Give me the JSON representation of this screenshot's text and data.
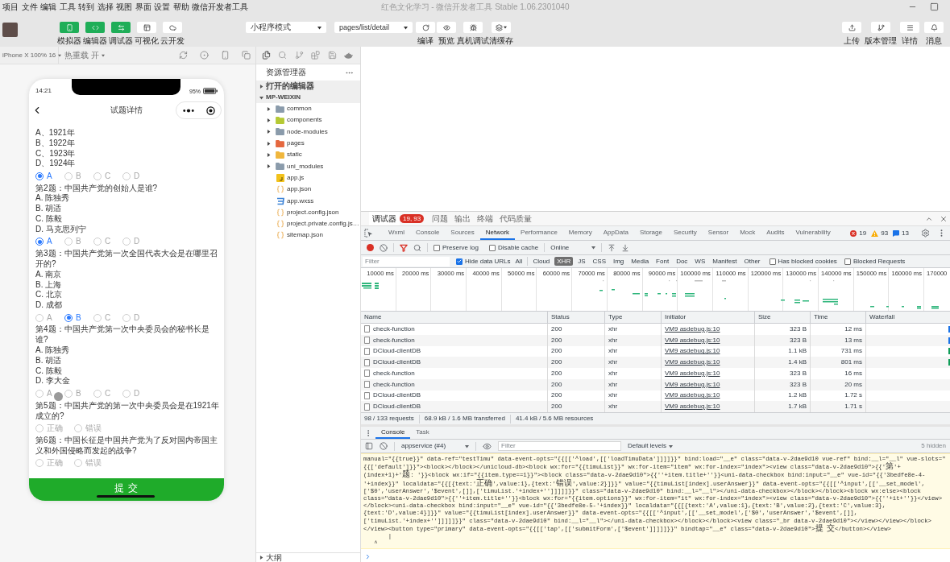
{
  "window": {
    "title": "红色文化学习 - 微信开发者工具 Stable 1.06.2301040"
  },
  "menu": [
    "项目",
    "文件",
    "编辑",
    "工具",
    "转到",
    "选择",
    "视图",
    "界面",
    "设置",
    "帮助",
    "微信开发者工具"
  ],
  "toolbar": {
    "modes": [
      {
        "kind": "simulator",
        "label": "模拟器",
        "selected": true
      },
      {
        "kind": "editor",
        "label": "编辑器",
        "selected": true
      },
      {
        "kind": "debugger",
        "label": "调试器",
        "selected": true
      },
      {
        "kind": "visual",
        "label": "可视化",
        "selected": false
      },
      {
        "kind": "cloud",
        "label": "云开发",
        "selected": false
      }
    ],
    "compile_mode": "小程序模式",
    "page_path": "pages/list/detail",
    "actions": [
      {
        "kind": "compile",
        "label": "编译"
      },
      {
        "kind": "preview",
        "label": "预览"
      },
      {
        "kind": "debug",
        "label": "真机调试"
      },
      {
        "kind": "cache",
        "label": "清缓存"
      }
    ],
    "right_actions": [
      {
        "kind": "upload",
        "label": "上传"
      },
      {
        "kind": "version",
        "label": "版本管理"
      },
      {
        "kind": "details",
        "label": "详情"
      },
      {
        "kind": "messages",
        "label": "消息"
      }
    ]
  },
  "simulator": {
    "device": "iPhone X 100% 16",
    "hot_reload": "热重载 开",
    "phone": {
      "time": "14:21",
      "battery": "95%",
      "title": "试题详情",
      "questions": [
        {
          "options": [
            "A、1921年",
            "B、1922年",
            "C、1923年",
            "D、1924年"
          ],
          "choices": [
            {
              "label": "A",
              "selected": true
            },
            {
              "label": "B",
              "selected": false
            },
            {
              "label": "C",
              "selected": false
            },
            {
              "label": "D",
              "selected": false
            }
          ]
        },
        {
          "title": "第2题：中国共产党的创始人是谁?",
          "options": [
            "A. 陈独秀",
            "B. 胡适",
            "C. 陈毅",
            "D. 马克思列宁"
          ],
          "choices": [
            {
              "label": "A",
              "selected": true
            },
            {
              "label": "B",
              "selected": false
            },
            {
              "label": "C",
              "selected": false
            },
            {
              "label": "D",
              "selected": false
            }
          ]
        },
        {
          "title": "第3题：中国共产党第一次全国代表大会是在哪里召开的?",
          "options": [
            "A. 南京",
            "B. 上海",
            "C. 北京",
            "D. 成都"
          ],
          "choices": [
            {
              "label": "A",
              "selected": false
            },
            {
              "label": "B",
              "selected": true
            },
            {
              "label": "C",
              "selected": false
            },
            {
              "label": "D",
              "selected": false
            }
          ]
        },
        {
          "title": "第4题：中国共产党第一次中央委员会的秘书长是谁?",
          "options": [
            "A. 陈独秀",
            "B. 胡适",
            "C. 陈毅",
            "D. 李大金"
          ],
          "choices": [
            {
              "label": "A",
              "selected": false
            },
            {
              "label": "B",
              "selected": false
            },
            {
              "label": "C",
              "selected": false
            },
            {
              "label": "D",
              "selected": false
            }
          ]
        },
        {
          "title": "第5题：中国共产党的第一次中央委员会是在1921年成立的?",
          "choices": [
            {
              "label": "正确",
              "selected": false
            },
            {
              "label": "错误",
              "selected": false
            }
          ]
        },
        {
          "title": "第6题：中国长征是中国共产党为了反对国内帝国主义和外国侵略而发起的战争?",
          "choices": [
            {
              "label": "正确",
              "selected": false
            },
            {
              "label": "错误",
              "selected": false
            }
          ]
        }
      ],
      "submit": "提 交"
    }
  },
  "explorer": {
    "title": "资源管理器",
    "sections": [
      {
        "label": "打开的编辑器",
        "expanded": false
      },
      {
        "label": "MP-WEIXIN",
        "expanded": true,
        "children": [
          {
            "label": "common",
            "kind": "folder",
            "expanded": false,
            "color": "#8a9bab"
          },
          {
            "label": "components",
            "kind": "folder",
            "expanded": false,
            "color": "#b5c934"
          },
          {
            "label": "node-modules",
            "kind": "folder",
            "expanded": false,
            "color": "#8a9bab"
          },
          {
            "label": "pages",
            "kind": "folder",
            "expanded": false,
            "color": "#e5683f"
          },
          {
            "label": "static",
            "kind": "folder",
            "expanded": false,
            "color": "#f0b63c"
          },
          {
            "label": "uni_modules",
            "kind": "folder",
            "expanded": false,
            "color": "#8a9bab"
          },
          {
            "label": "app.js",
            "kind": "js"
          },
          {
            "label": "app.json",
            "kind": "json"
          },
          {
            "label": "app.wxss",
            "kind": "css"
          },
          {
            "label": "project.config.json",
            "kind": "json"
          },
          {
            "label": "project.private.config.js…",
            "kind": "json"
          },
          {
            "label": "sitemap.json",
            "kind": "json"
          }
        ]
      }
    ],
    "outline": {
      "label": "大纲",
      "expanded": false
    }
  },
  "devtools": {
    "panels": [
      {
        "label": "调试器",
        "selected": true,
        "badge": "19, 93"
      },
      {
        "label": "问题",
        "selected": false
      },
      {
        "label": "输出",
        "selected": false
      },
      {
        "label": "终端",
        "selected": false
      },
      {
        "label": "代码质量",
        "selected": false
      }
    ],
    "tabs": [
      {
        "label": "Wxml",
        "selected": false
      },
      {
        "label": "Console",
        "selected": false
      },
      {
        "label": "Sources",
        "selected": false
      },
      {
        "label": "Network",
        "selected": true
      },
      {
        "label": "Performance",
        "selected": false
      },
      {
        "label": "Memory",
        "selected": false
      },
      {
        "label": "AppData",
        "selected": false
      },
      {
        "label": "Storage",
        "selected": false
      },
      {
        "label": "Security",
        "selected": false
      },
      {
        "label": "Sensor",
        "selected": false
      },
      {
        "label": "Mock",
        "selected": false
      },
      {
        "label": "Audits",
        "selected": false
      },
      {
        "label": "Vulnerability",
        "selected": false
      }
    ],
    "counts": {
      "errors": "19",
      "warnings": "93",
      "messages": "13"
    },
    "network": {
      "recording": true,
      "filter_shown": true,
      "preserve_log": {
        "label": "Preserve log",
        "checked": false
      },
      "disable_cache": {
        "label": "Disable cache",
        "checked": false
      },
      "throttling": "Online",
      "filter": {
        "placeholder": "Filter",
        "hide_data_urls": {
          "label": "Hide data URLs",
          "checked": true
        },
        "types": [
          {
            "label": "All",
            "selected": false
          },
          {
            "label": "Cloud",
            "selected": false
          },
          {
            "label": "XHR",
            "selected": true
          },
          {
            "label": "JS",
            "selected": false
          },
          {
            "label": "CSS",
            "selected": false
          },
          {
            "label": "Img",
            "selected": false
          },
          {
            "label": "Media",
            "selected": false
          },
          {
            "label": "Font",
            "selected": false
          },
          {
            "label": "Doc",
            "selected": false
          },
          {
            "label": "WS",
            "selected": false
          },
          {
            "label": "Manifest",
            "selected": false
          },
          {
            "label": "Other",
            "selected": false
          }
        ],
        "blocked_cookies": {
          "label": "Has blocked cookies",
          "checked": false
        },
        "blocked_requests": {
          "label": "Blocked Requests",
          "checked": false
        }
      },
      "overview_ticks": [
        "10000 ms",
        "20000 ms",
        "30000 ms",
        "40000 ms",
        "50000 ms",
        "60000 ms",
        "70000 ms",
        "80000 ms",
        "90000 ms",
        "100000 ms",
        "110000 ms",
        "120000 ms",
        "130000 ms",
        "140000 ms",
        "150000 ms",
        "160000 ms",
        "170000"
      ],
      "columns": [
        "Name",
        "Status",
        "Type",
        "Initiator",
        "Size",
        "Time",
        "Waterfall"
      ],
      "rows": [
        {
          "name": "check-function",
          "status": "200",
          "type": "xhr",
          "initiator": "VM9 asdebug.js:10",
          "size": "323 B",
          "time": "12 ms",
          "color": "#1a73e8"
        },
        {
          "name": "check-function",
          "status": "200",
          "type": "xhr",
          "initiator": "VM9 asdebug.js:10",
          "size": "323 B",
          "time": "13 ms",
          "color": "#1a73e8"
        },
        {
          "name": "DCloud-clientDB",
          "status": "200",
          "type": "xhr",
          "initiator": "VM9 asdebug.js:10",
          "size": "1.1 kB",
          "time": "731 ms",
          "color": "#0f9d58"
        },
        {
          "name": "DCloud-clientDB",
          "status": "200",
          "type": "xhr",
          "initiator": "VM9 asdebug.js:10",
          "size": "1.4 kB",
          "time": "801 ms",
          "color": "#0f9d58"
        },
        {
          "name": "check-function",
          "status": "200",
          "type": "xhr",
          "initiator": "VM9 asdebug.js:10",
          "size": "323 B",
          "time": "16 ms"
        },
        {
          "name": "check-function",
          "status": "200",
          "type": "xhr",
          "initiator": "VM9 asdebug.js:10",
          "size": "323 B",
          "time": "20 ms"
        },
        {
          "name": "DCloud-clientDB",
          "status": "200",
          "type": "xhr",
          "initiator": "VM9 asdebug.js:10",
          "size": "1.2 kB",
          "time": "1.72 s"
        },
        {
          "name": "DCloud-clientDB",
          "status": "200",
          "type": "xhr",
          "initiator": "VM9 asdebug.js:10",
          "size": "1.7 kB",
          "time": "1.71 s"
        }
      ],
      "summary": [
        "98 / 133 requests",
        "68.9 kB / 1.6 MB transferred",
        "41.4 kB / 5.6 MB resources"
      ]
    },
    "console": {
      "tabs": [
        {
          "label": "Console",
          "selected": true
        },
        {
          "label": "Task",
          "selected": false
        }
      ],
      "context": "appservice (#4)",
      "filter_placeholder": "Filter",
      "levels": "Default levels",
      "hidden": "5 hidden",
      "output": [
        "manual=\"{{true}}\" data-ref=\"testTimu\" data-event-opts=\"{{[['^load',[['loadTimuData']]]]}}\" bind:load=\"__e\" class=\"data-v-2dae9d10 vue-ref\" bind:__l=\"__l\" vue-slots=\"",
        "{{['default']}}\"><block></block></unicloud-db><block wx:for=\"{{timuList}}\" wx:for-item=\"item\" wx:for-index=\"index\"><view class=\"data-v-2dae9d10\">{{'第'+",
        "(index+1)+'题: '}}<block wx:if=\"{{item.type==1}}\"><block class=\"data-v-2dae9d10\">{{''+item.title+''}}<uni-data-checkbox bind:input=\"__e\" vue-id=\"{{'3bedfe8e-4-",
        "'+index}}\" localdata=\"{{[{text:'正确',value:1},{text:'错误',value:2}]}}\" value=\"{{timuList[index].userAnswer}}\" data-event-opts=\"{{[['^input',[['__set_model',",
        "['$0','userAnswer','$event',[]],['timuList.'+index+'']]]]]}}\" class=\"data-v-2dae9d10\" bind:__l=\"__l\"></uni-data-checkbox></block></block><block wx:else><block",
        "class=\"data-v-2dae9d10\">{{''+item.title+''}}<block wx:for=\"{{item.options}}\" wx:for-item=\"it\" wx:for-index=\"index\"><view class=\"data-v-2dae9d10\">{{''+it+''}}</view>",
        "</block><uni-data-checkbox bind:input=\"__e\" vue-id=\"{{'3bedfe8e-5-'+index}}\" localdata=\"{{[{text:'A',value:1},{text:'B',value:2},{text:'C',value:3},",
        "{text:'D',value:4}]}}\" value=\"{{timuList[index].userAnswer}}\" data-event-opts=\"{{[['^input',[['__set_model',['$0','userAnswer','$event',[]],",
        "['timuList.'+index+'']]]]]}}\" class=\"data-v-2dae9d10\" bind:__l=\"__l\"></uni-data-checkbox></block></block><view class=\"_br data-v-2dae9d10\"></view></view></block>",
        "</view><button type=\"primary\" data-event-opts=\"{{[['tap',[['submitForm',['$event']]]]]}}\" bindtap=\"__e\" class=\"data-v-2dae9d10\">提 交</button></view>",
        "       |",
        "   ^"
      ]
    }
  }
}
